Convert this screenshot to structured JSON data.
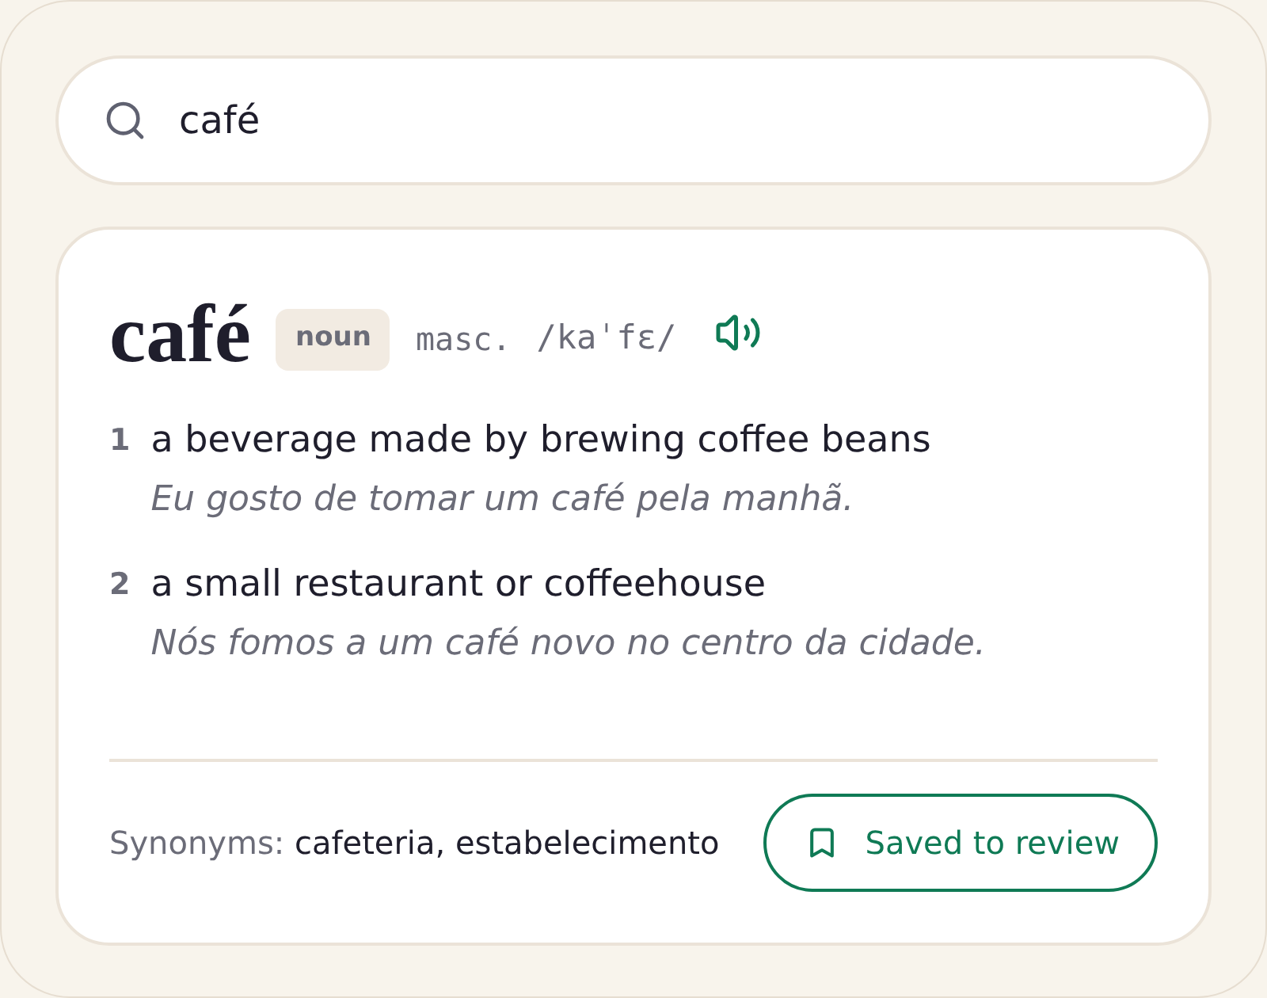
{
  "search": {
    "value": "café"
  },
  "entry": {
    "headword": "café",
    "part_of_speech": "noun",
    "gender": "masc.",
    "pronunciation": "/kaˈfɛ/",
    "senses": [
      {
        "number": "1",
        "definition": "a beverage made by brewing coffee beans",
        "example": "Eu gosto de tomar um café pela manhã."
      },
      {
        "number": "2",
        "definition": "a small restaurant or coffeehouse",
        "example": "Nós fomos a um café novo no centro da cidade."
      }
    ]
  },
  "footer": {
    "synonyms_label": "Synonyms:",
    "synonyms": "cafeteria, estabelecimento",
    "save_button": {
      "label": "Saved to review",
      "saved": true
    }
  }
}
